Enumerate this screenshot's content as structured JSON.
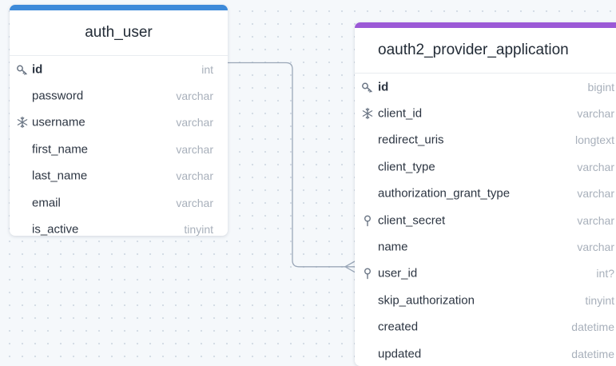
{
  "tables": [
    {
      "id": "auth-user",
      "name": "auth_user",
      "accent_color": "#3d8ad9",
      "fields": [
        {
          "name": "id",
          "type": "int",
          "icon": "key-icon",
          "primary": true
        },
        {
          "name": "password",
          "type": "varchar",
          "icon": "",
          "primary": false
        },
        {
          "name": "username",
          "type": "varchar",
          "icon": "snowflake-icon",
          "primary": false
        },
        {
          "name": "first_name",
          "type": "varchar",
          "icon": "",
          "primary": false
        },
        {
          "name": "last_name",
          "type": "varchar",
          "icon": "",
          "primary": false
        },
        {
          "name": "email",
          "type": "varchar",
          "icon": "",
          "primary": false
        },
        {
          "name": "is_active",
          "type": "tinyint",
          "icon": "",
          "primary": false
        }
      ]
    },
    {
      "id": "oauth-app",
      "name": "oauth2_provider_application",
      "accent_color": "#9b59d6",
      "fields": [
        {
          "name": "id",
          "type": "bigint",
          "icon": "key-icon",
          "primary": true
        },
        {
          "name": "client_id",
          "type": "varchar",
          "icon": "snowflake-icon",
          "primary": false
        },
        {
          "name": "redirect_uris",
          "type": "longtext",
          "icon": "",
          "primary": false
        },
        {
          "name": "client_type",
          "type": "varchar",
          "icon": "",
          "primary": false
        },
        {
          "name": "authorization_grant_type",
          "type": "varchar",
          "icon": "",
          "primary": false
        },
        {
          "name": "client_secret",
          "type": "varchar",
          "icon": "index-icon",
          "primary": false
        },
        {
          "name": "name",
          "type": "varchar",
          "icon": "",
          "primary": false
        },
        {
          "name": "user_id",
          "type": "int?",
          "icon": "index-icon",
          "primary": false
        },
        {
          "name": "skip_authorization",
          "type": "tinyint",
          "icon": "",
          "primary": false
        },
        {
          "name": "created",
          "type": "datetime",
          "icon": "",
          "primary": false
        },
        {
          "name": "updated",
          "type": "datetime",
          "icon": "",
          "primary": false
        }
      ]
    }
  ],
  "relationships": [
    {
      "from_table": "auth_user",
      "from_field": "id",
      "to_table": "oauth2_provider_application",
      "to_field": "user_id",
      "cardinality": "one-to-many"
    }
  ],
  "colors": {
    "connector": "#9aa7b8",
    "icon": "#6b7685"
  }
}
